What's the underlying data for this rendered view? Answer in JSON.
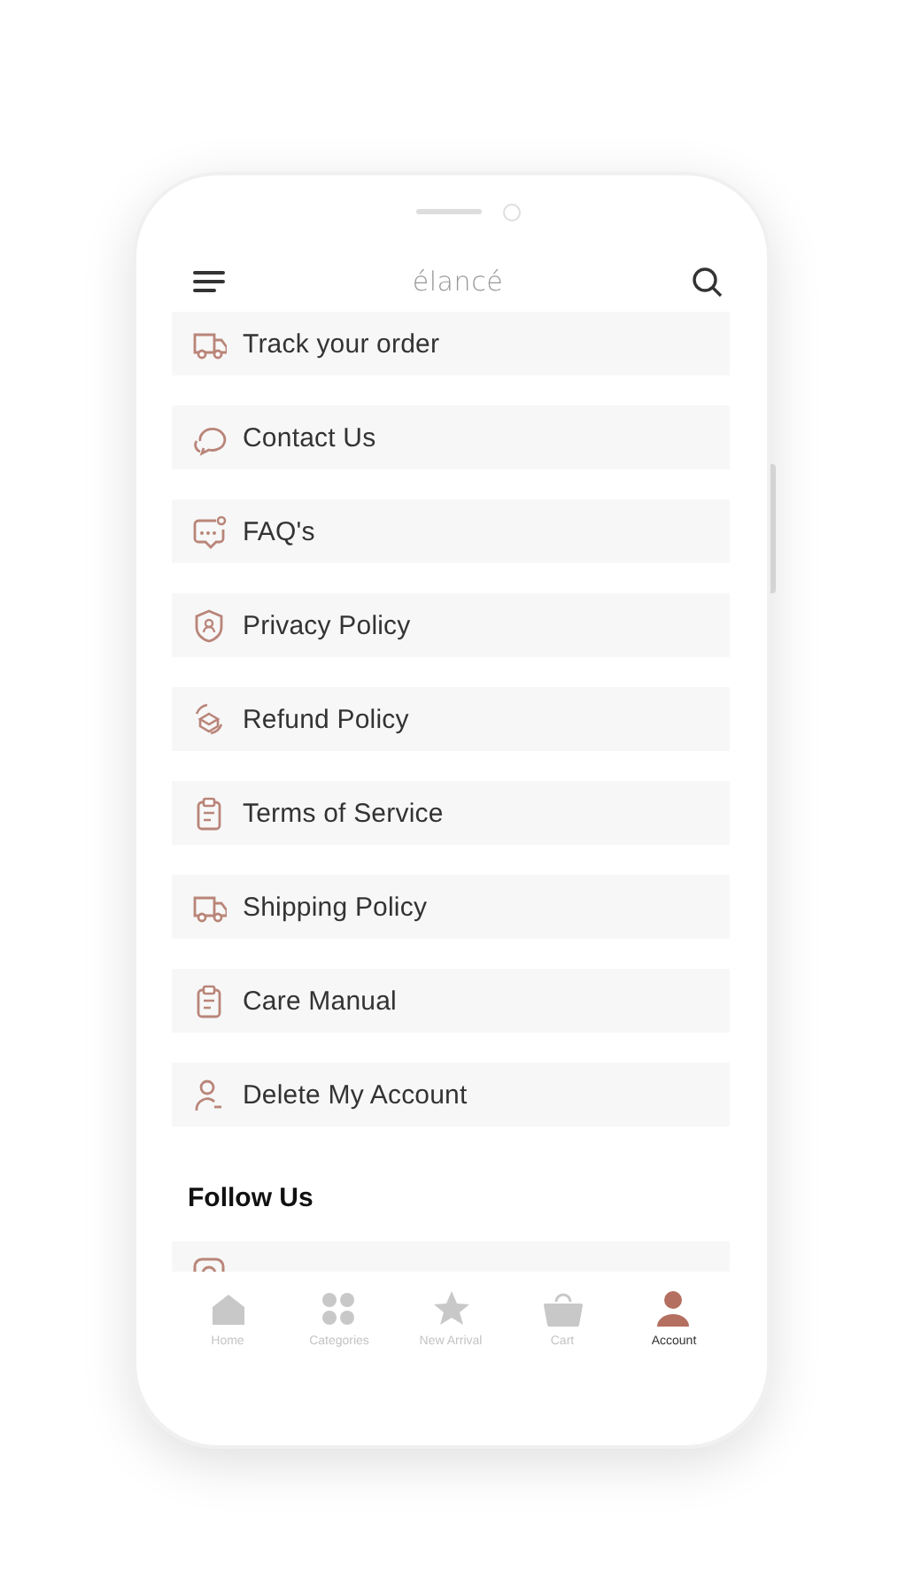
{
  "header": {
    "logo": "élancé"
  },
  "menu_items": [
    {
      "label": "Track your order"
    },
    {
      "label": "Contact Us"
    },
    {
      "label": "FAQ's"
    },
    {
      "label": "Privacy Policy"
    },
    {
      "label": "Refund Policy"
    },
    {
      "label": "Terms of Service"
    },
    {
      "label": "Shipping Policy"
    },
    {
      "label": "Care Manual"
    },
    {
      "label": "Delete My Account"
    }
  ],
  "follow_section": {
    "title": "Follow Us"
  },
  "bottom_nav": [
    {
      "label": "Home",
      "selected": false
    },
    {
      "label": "Categories",
      "selected": false
    },
    {
      "label": "New Arrival",
      "selected": false
    },
    {
      "label": "Cart",
      "selected": false
    },
    {
      "label": "Account",
      "selected": true
    }
  ]
}
